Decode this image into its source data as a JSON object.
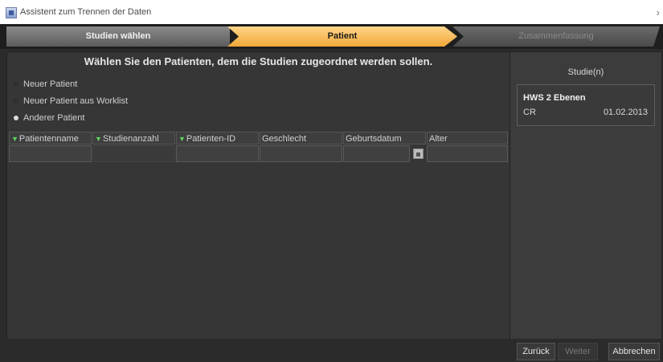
{
  "window": {
    "title": "Assistent zum Trennen der Daten"
  },
  "steps": [
    "Studien wählen",
    "Patient",
    "Zusammenfassung"
  ],
  "main": {
    "heading": "Wählen Sie den Patienten, dem die Studien zugeordnet werden sollen.",
    "options": [
      "Neuer Patient",
      "Neuer Patient aus Worklist",
      "Anderer Patient"
    ],
    "selected_option": "Anderer Patient",
    "columns": [
      "Patientenname",
      "Studienanzahl",
      "Patienten-ID",
      "Geschlecht",
      "Geburtsdatum",
      "Alter"
    ]
  },
  "side": {
    "title": "Studie(n)",
    "study": {
      "name": "HWS 2 Ebenen",
      "modality": "CR",
      "date": "01.02.2013"
    }
  },
  "buttons": {
    "back": "Zurück",
    "next": "Weiter",
    "cancel": "Abbrechen"
  }
}
